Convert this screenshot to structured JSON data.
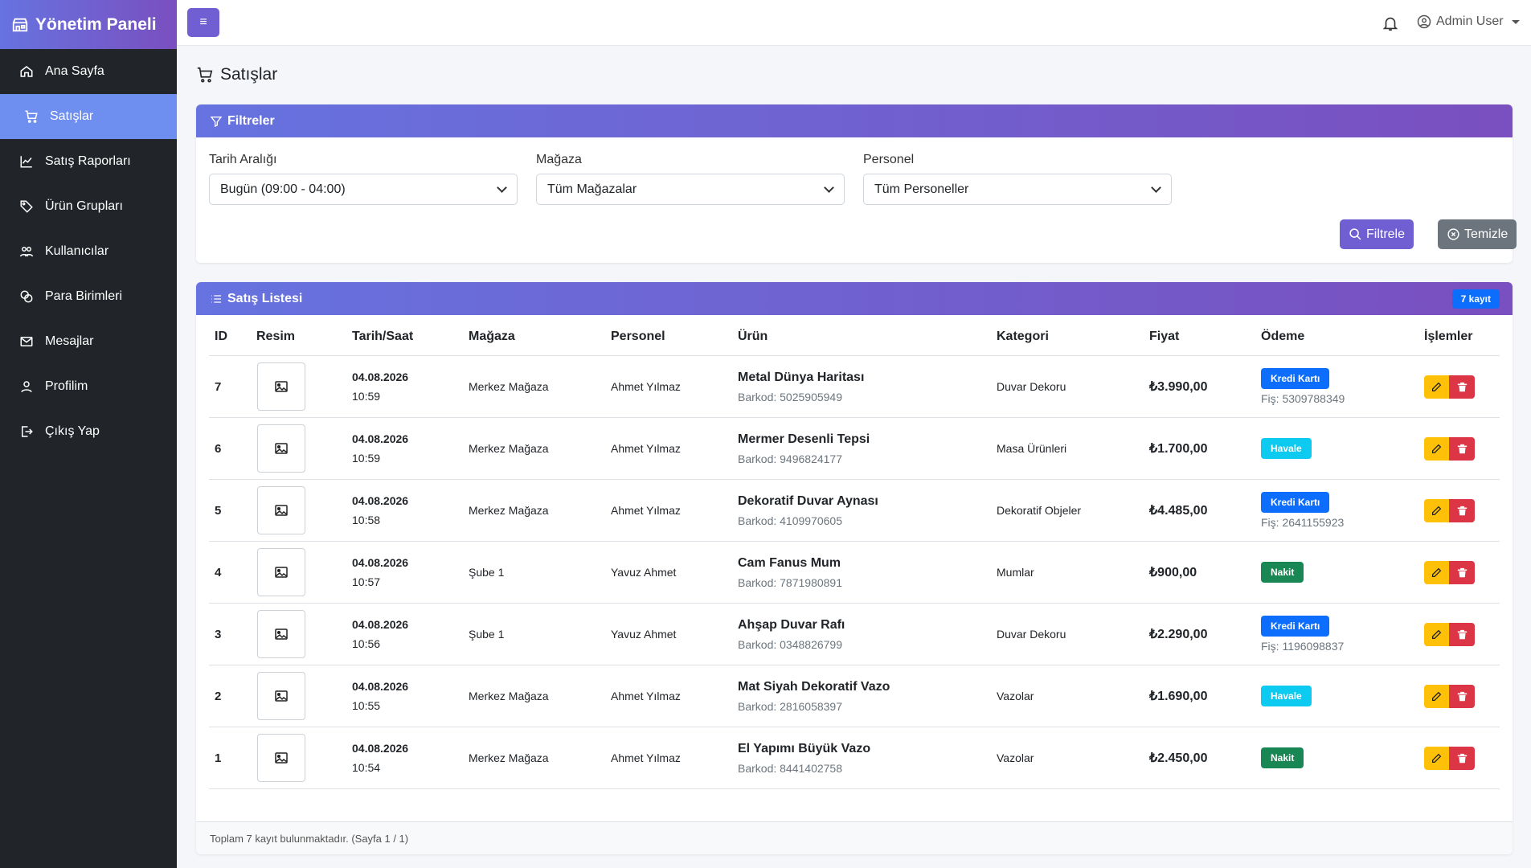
{
  "brand": {
    "title": "Yönetim Paneli"
  },
  "sidebar": {
    "items": [
      {
        "label": "Ana Sayfa",
        "icon": "home-icon"
      },
      {
        "label": "Satışlar",
        "icon": "cart-icon",
        "active": true
      },
      {
        "label": "Satış Raporları",
        "icon": "chart-line-icon"
      },
      {
        "label": "Ürün Grupları",
        "icon": "tags-icon"
      },
      {
        "label": "Kullanıcılar",
        "icon": "users-icon"
      },
      {
        "label": "Para Birimleri",
        "icon": "coins-icon"
      },
      {
        "label": "Mesajlar",
        "icon": "envelope-icon"
      },
      {
        "label": "Profilim",
        "icon": "person-icon"
      },
      {
        "label": "Çıkış Yap",
        "icon": "logout-icon"
      }
    ]
  },
  "topbar": {
    "menu_glyph": "≡",
    "user_name": "Admin User"
  },
  "page": {
    "title": "Satışlar"
  },
  "filters": {
    "header": "Filtreler",
    "date_label": "Tarih Aralığı",
    "date_value": "Bugün (09:00 - 04:00)",
    "store_label": "Mağaza",
    "store_value": "Tüm Mağazalar",
    "staff_label": "Personel",
    "staff_value": "Tüm Personeller",
    "filter_button": "Filtrele",
    "clear_button": "Temizle"
  },
  "sales": {
    "header": "Satış Listesi",
    "count_badge": "7 kayıt",
    "columns": [
      "ID",
      "Resim",
      "Tarih/Saat",
      "Mağaza",
      "Personel",
      "Ürün",
      "Kategori",
      "Fiyat",
      "Ödeme",
      "İşlemler"
    ],
    "rows": [
      {
        "id": "7",
        "date": "04.08.2026",
        "time": "10:59",
        "store": "Merkez Mağaza",
        "staff": "Ahmet Yılmaz",
        "product": "Metal Dünya Haritası",
        "barcode": "Barkod: 5025905949",
        "category": "Duvar Dekoru",
        "price": "₺3.990,00",
        "payment": "Kredi Kartı",
        "payment_type": "kredi",
        "receipt": "Fiş: 5309788349"
      },
      {
        "id": "6",
        "date": "04.08.2026",
        "time": "10:59",
        "store": "Merkez Mağaza",
        "staff": "Ahmet Yılmaz",
        "product": "Mermer Desenli Tepsi",
        "barcode": "Barkod: 9496824177",
        "category": "Masa Ürünleri",
        "price": "₺1.700,00",
        "payment": "Havale",
        "payment_type": "havale",
        "receipt": ""
      },
      {
        "id": "5",
        "date": "04.08.2026",
        "time": "10:58",
        "store": "Merkez Mağaza",
        "staff": "Ahmet Yılmaz",
        "product": "Dekoratif Duvar Aynası",
        "barcode": "Barkod: 4109970605",
        "category": "Dekoratif Objeler",
        "price": "₺4.485,00",
        "payment": "Kredi Kartı",
        "payment_type": "kredi",
        "receipt": "Fiş: 2641155923"
      },
      {
        "id": "4",
        "date": "04.08.2026",
        "time": "10:57",
        "store": "Şube 1",
        "staff": "Yavuz Ahmet",
        "product": "Cam Fanus Mum",
        "barcode": "Barkod: 7871980891",
        "category": "Mumlar",
        "price": "₺900,00",
        "payment": "Nakit",
        "payment_type": "nakit",
        "receipt": ""
      },
      {
        "id": "3",
        "date": "04.08.2026",
        "time": "10:56",
        "store": "Şube 1",
        "staff": "Yavuz Ahmet",
        "product": "Ahşap Duvar Rafı",
        "barcode": "Barkod: 0348826799",
        "category": "Duvar Dekoru",
        "price": "₺2.290,00",
        "payment": "Kredi Kartı",
        "payment_type": "kredi",
        "receipt": "Fiş: 1196098837"
      },
      {
        "id": "2",
        "date": "04.08.2026",
        "time": "10:55",
        "store": "Merkez Mağaza",
        "staff": "Ahmet Yılmaz",
        "product": "Mat Siyah Dekoratif Vazo",
        "barcode": "Barkod: 2816058397",
        "category": "Vazolar",
        "price": "₺1.690,00",
        "payment": "Havale",
        "payment_type": "havale",
        "receipt": ""
      },
      {
        "id": "1",
        "date": "04.08.2026",
        "time": "10:54",
        "store": "Merkez Mağaza",
        "staff": "Ahmet Yılmaz",
        "product": "El Yapımı Büyük Vazo",
        "barcode": "Barkod: 8441402758",
        "category": "Vazolar",
        "price": "₺2.450,00",
        "payment": "Nakit",
        "payment_type": "nakit",
        "receipt": ""
      }
    ],
    "footer": "Toplam 7 kayıt bulunmaktadır. (Sayfa 1 / 1)"
  },
  "colors": {
    "accent": "#6f5fd2",
    "sidebar_bg": "#212529",
    "active_item": "#6e8ef0",
    "kredi": "#0d6efd",
    "havale": "#0dcaf0",
    "nakit": "#198754",
    "edit": "#ffc107",
    "delete": "#dc3545"
  }
}
